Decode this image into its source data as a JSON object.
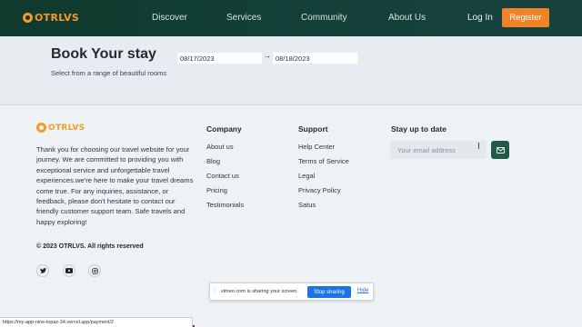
{
  "brand": {
    "name": "OTRLVS",
    "accent": "#f0822a"
  },
  "nav": {
    "discover": "Discover",
    "services": "Services",
    "community": "Community",
    "about": "About Us",
    "login": "Log In",
    "register": "Register"
  },
  "booking": {
    "title": "Book Your stay",
    "subtitle": "Select from a range of beautiful rooms",
    "start_date": "08/17/2023",
    "end_date": "08/18/2023"
  },
  "footer": {
    "about": "Thank you for choosing our travel website for your journey. We are committed to providing you with exceptional service and unforgettable travel experiences.we're here to make your travel dreams come true. For any inquiries, assistance, or feedback, please don't hesitate to contact our friendly customer support team. Safe travels and happy exploring!",
    "copyright": "© 2023 OTRLVS. All rights reserved",
    "company": {
      "title": "Company",
      "links": [
        "About us",
        "Blog",
        "Contact us",
        "Pricing",
        "Testimonials"
      ]
    },
    "support": {
      "title": "Support",
      "links": [
        "Help Center",
        "Terms of Service",
        "Legal",
        "Privacy Policy",
        "Satus"
      ]
    },
    "newsletter": {
      "title": "Stay up to date",
      "placeholder": "Your email address"
    },
    "social": [
      "twitter-icon",
      "youtube-icon",
      "instagram-icon"
    ]
  },
  "share_bar": {
    "text": "vimeo.com is sharing your screen.",
    "stop": "Stop sharing",
    "hide": "Hide"
  },
  "status_url": "https://my-app-nine-topaz-34.vercel.app/payment/2"
}
